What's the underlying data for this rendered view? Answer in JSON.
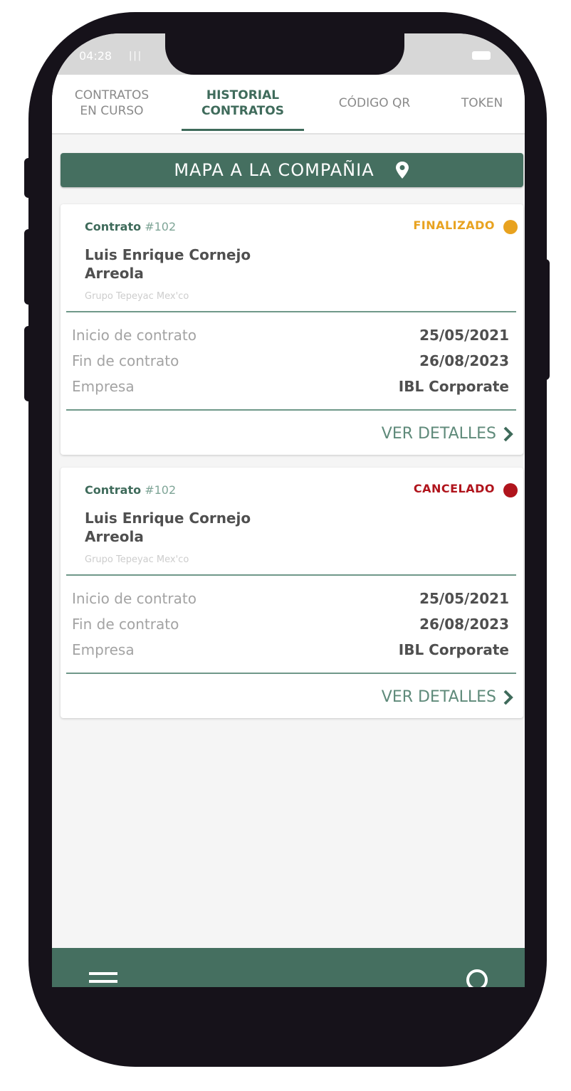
{
  "status_bar": {
    "time": "04:28",
    "signal": "|||"
  },
  "tabs": [
    {
      "label": "CONTRATOS\nEN CURSO"
    },
    {
      "label": "HISTORIAL\nCONTRATOS"
    },
    {
      "label": "CÓDIGO QR"
    },
    {
      "label": "TOKEN"
    }
  ],
  "active_tab": 1,
  "map_button": {
    "label": "MAPA A LA COMPAÑIA",
    "icon": "location-pin-icon"
  },
  "cards": [
    {
      "contract_label": "Contrato",
      "contract_number": "#102",
      "status": "FINALIZADO",
      "status_color": "#e8a21f",
      "name": "Luis Enrique Cornejo Arreola",
      "company_group": "Grupo Tepeyac Mex'co",
      "rows": [
        {
          "label": "Inicio de contrato",
          "value": "25/05/2021"
        },
        {
          "label": "Fin de contrato",
          "value": "26/08/2023"
        },
        {
          "label": "Empresa",
          "value": "IBL Corporate"
        }
      ],
      "details_label": "VER DETALLES"
    },
    {
      "contract_label": "Contrato",
      "contract_number": "#102",
      "status": "CANCELADO",
      "status_color": "#b0141c",
      "name": "Luis Enrique Cornejo Arreola",
      "company_group": "Grupo Tepeyac Mex'co",
      "rows": [
        {
          "label": "Inicio de contrato",
          "value": "25/05/2021"
        },
        {
          "label": "Fin de contrato",
          "value": "26/08/2023"
        },
        {
          "label": "Empresa",
          "value": "IBL Corporate"
        }
      ],
      "details_label": "VER DETALLES"
    }
  ],
  "bottom_bar": {
    "left_icon": "menu-icon",
    "right_icon": "search-icon"
  },
  "colors": {
    "primary": "#456f60",
    "finalizado": "#e8a21f",
    "cancelado": "#b0141c"
  }
}
